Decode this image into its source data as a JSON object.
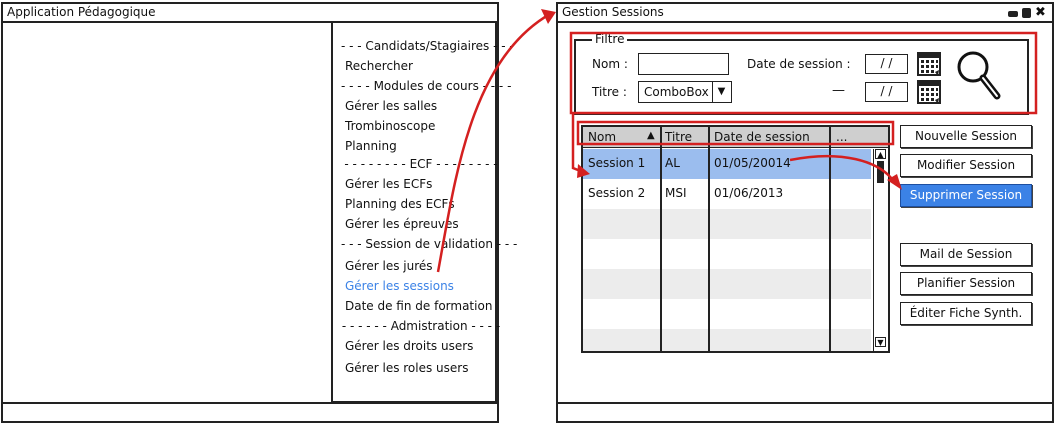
{
  "left_window": {
    "title": "Application Pédagogique",
    "menu": [
      {
        "kind": "sep",
        "label": "- - - Candidats/Stagiaires - - -"
      },
      {
        "kind": "item",
        "label": "Rechercher"
      },
      {
        "kind": "sep",
        "label": "- - - - Modules de cours - - - -"
      },
      {
        "kind": "item",
        "label": "Gérer les salles"
      },
      {
        "kind": "item",
        "label": "Trombinoscope"
      },
      {
        "kind": "item",
        "label": "Planning"
      },
      {
        "kind": "sep",
        "label": "- - - - - - - - ECF - - - - - - - -"
      },
      {
        "kind": "item",
        "label": "Gérer les ECFs"
      },
      {
        "kind": "item",
        "label": "Planning des ECFs"
      },
      {
        "kind": "item",
        "label": "Gérer les épreuves"
      },
      {
        "kind": "sep",
        "label": "- - - Session de validation - - -"
      },
      {
        "kind": "item",
        "label": "Gérer les jurés"
      },
      {
        "kind": "item",
        "label": "Gérer les sessions",
        "active": true
      },
      {
        "kind": "item",
        "label": "Date de fin de formation"
      },
      {
        "kind": "sep",
        "label": "- - - - - - Admistration - - - -"
      },
      {
        "kind": "item",
        "label": "Gérer les droits users"
      },
      {
        "kind": "item",
        "label": "Gérer les roles users"
      }
    ]
  },
  "right_window": {
    "title": "Gestion Sessions",
    "window_controls": [
      "minimize-icon",
      "maximize-icon",
      "close-icon"
    ],
    "filter": {
      "legend": "Filtre",
      "nom_label": "Nom :",
      "nom_value": "",
      "titre_label": "Titre :",
      "titre_value": "ComboBox",
      "date_label": "Date de session :",
      "date_from": "/ /",
      "date_to": "/ /",
      "range_dash": "—"
    },
    "table": {
      "columns": [
        "Nom",
        "Titre",
        "Date de session",
        "..."
      ],
      "sort_indicator": "▲",
      "rows": [
        {
          "nom": "Session 1",
          "titre": "AL",
          "date": "01/05/20014",
          "selected": true
        },
        {
          "nom": "Session 2",
          "titre": "MSI",
          "date": "01/06/2013",
          "selected": false
        }
      ]
    },
    "buttons": {
      "new": "Nouvelle Session",
      "edit": "Modifier Session",
      "delete": "Supprimer Session",
      "mail": "Mail de Session",
      "plan": "Planifier Session",
      "sheet": "Éditer Fiche Synth."
    }
  },
  "colors": {
    "annotation": "#d42020",
    "selection": "#9bbdee",
    "link": "#3b82e6",
    "button_active": "#3b82e6"
  }
}
